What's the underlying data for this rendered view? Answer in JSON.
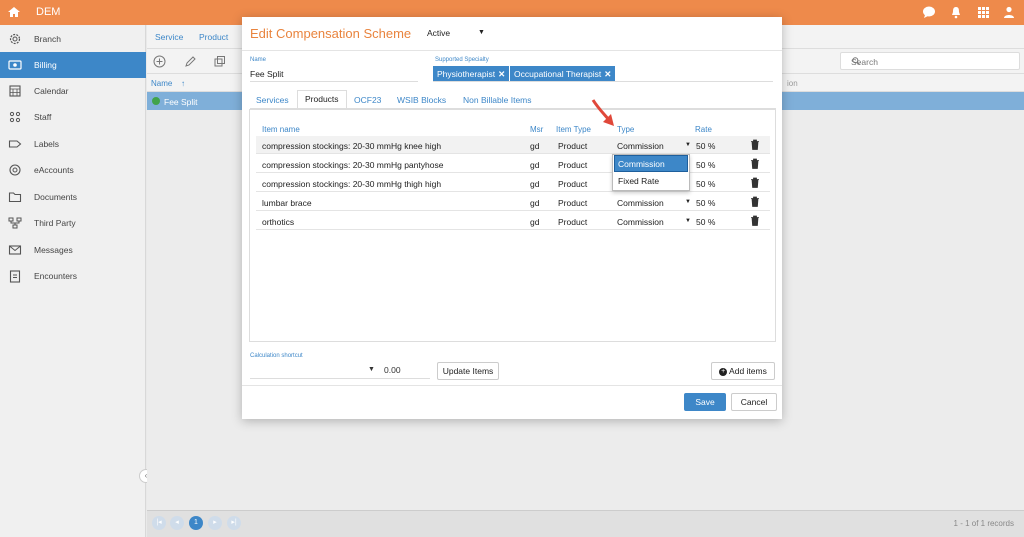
{
  "app": {
    "name": "DEM"
  },
  "sidebar": {
    "items": [
      {
        "label": "Branch",
        "icon": "gear-icon"
      },
      {
        "label": "Billing",
        "icon": "billing-icon",
        "active": true
      },
      {
        "label": "Calendar",
        "icon": "calendar-icon"
      },
      {
        "label": "Staff",
        "icon": "staff-icon"
      },
      {
        "label": "Labels",
        "icon": "tag-icon"
      },
      {
        "label": "eAccounts",
        "icon": "at-icon"
      },
      {
        "label": "Documents",
        "icon": "folder-icon"
      },
      {
        "label": "Third Party",
        "icon": "org-chart-icon"
      },
      {
        "label": "Messages",
        "icon": "envelope-icon"
      },
      {
        "label": "Encounters",
        "icon": "clipboard-icon"
      }
    ]
  },
  "background": {
    "tabs": [
      "Service",
      "Product"
    ],
    "search_placeholder": "Search",
    "column_header": "Name",
    "column_header_partial": "ion",
    "row_name": "Fee Split",
    "page_current": "1",
    "records_text": "1 - 1 of 1 records"
  },
  "modal": {
    "title": "Edit Compensation Scheme",
    "status": "Active",
    "name_label": "Name",
    "name_value": "Fee Split",
    "specialty_label": "Supported Specialty",
    "specialties": [
      "Physiotherapist",
      "Occupational Therapist"
    ],
    "tabs": [
      "Services",
      "Products",
      "OCF23",
      "WSIB Blocks",
      "Non Billable Items"
    ],
    "active_tab": "Products",
    "columns": {
      "item_name": "Item name",
      "msr": "Msr",
      "item_type": "Item Type",
      "type": "Type",
      "rate": "Rate"
    },
    "rows": [
      {
        "name": "compression stockings: 20-30 mmHg knee high",
        "msr": "gd",
        "item_type": "Product",
        "type": "Commission",
        "rate": "50 %"
      },
      {
        "name": "compression stockings: 20-30 mmHg pantyhose",
        "msr": "gd",
        "item_type": "Product",
        "type": "",
        "rate": "50 %"
      },
      {
        "name": "compression stockings: 20-30 mmHg thigh high",
        "msr": "gd",
        "item_type": "Product",
        "type": "",
        "rate": "50 %"
      },
      {
        "name": "lumbar brace",
        "msr": "gd",
        "item_type": "Product",
        "type": "Commission",
        "rate": "50 %"
      },
      {
        "name": "orthotics",
        "msr": "gd",
        "item_type": "Product",
        "type": "Commission",
        "rate": "50 %"
      }
    ],
    "dropdown_options": [
      "Commission",
      "Fixed Rate"
    ],
    "dropdown_selected": "Commission",
    "calc_label": "Calculation shortcut",
    "calc_value": "0.00",
    "update_button": "Update Items",
    "add_button": "Add items",
    "save_button": "Save",
    "cancel_button": "Cancel"
  },
  "colors": {
    "accent": "#ee8a4b",
    "primary": "#3d87c8",
    "status_green": "#41a34a",
    "annotation_arrow": "#e0483a"
  }
}
